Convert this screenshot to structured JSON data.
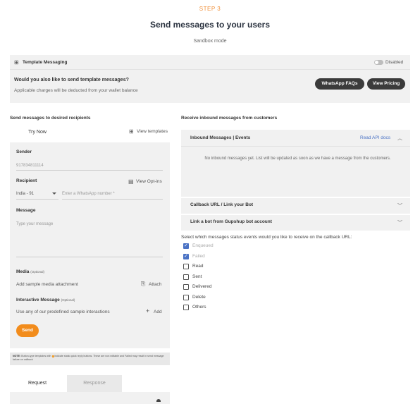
{
  "header": {
    "step": "STEP 3",
    "title": "Send messages to your users",
    "mode": "Sandbox mode"
  },
  "template_messaging": {
    "icon": "template-icon",
    "label": "Template Messaging",
    "toggle_state": "Disabled",
    "question": "Would you also like to send template messages?",
    "subtext": "Applicable charges will be deducted from your wallet balance",
    "faq_button": "WhatsApp FAQs",
    "pricing_button": "View Pricing"
  },
  "left": {
    "section_title": "Send messages to desired recipients",
    "tab_try": "Try Now",
    "view_templates": "View templates",
    "sender_label": "Sender",
    "sender_value": "917834811114",
    "recipient_label": "Recipient",
    "view_optins": "View Opt-ins",
    "country_code": "India - 91",
    "number_placeholder": "Enter a WhatsApp number *",
    "message_label": "Message",
    "message_placeholder": "Type your message",
    "media_label": "Media",
    "media_optional": "(Optional)",
    "media_text": "Add sample media attachment",
    "attach_label": "Attach",
    "interactive_label": "Interactive Message",
    "interactive_optional": "(Optional)",
    "interactive_text": "Use any of our predefined sample interactions",
    "add_label": "Add",
    "send_button": "Send",
    "note_prefix": "NOTE:",
    "note_part1": "Button-type templates with",
    "note_part2": "indicate static quick reply buttons. These are non editable and",
    "note_part3": "Failed may result in send message failure on callback",
    "tab_request": "Request",
    "tab_response": "Response"
  },
  "right": {
    "section_title": "Receive inbound messages from customers",
    "inbound_title": "Inbound Messages | Events",
    "api_docs": "Read API docs",
    "inbound_empty": "No inbound messages yet. List will be updated as soon as we have a message from the customers.",
    "callback_title": "Callback URL / Link your Bot",
    "gupshup_title": "Link a bot from Gupshup bot account",
    "status_question": "Select which messages status events would you like to receive on the callback URL:",
    "statuses": [
      {
        "label": "Enqueued",
        "checked": true
      },
      {
        "label": "Failed",
        "checked": true
      },
      {
        "label": "Read",
        "checked": false
      },
      {
        "label": "Sent",
        "checked": false
      },
      {
        "label": "Delivered",
        "checked": false
      },
      {
        "label": "Delete",
        "checked": false
      },
      {
        "label": "Others",
        "checked": false
      }
    ]
  },
  "colors": {
    "accent_orange": "#f28c1c",
    "link_blue": "#4a72c4",
    "panel_gray": "#f1f1f1"
  }
}
